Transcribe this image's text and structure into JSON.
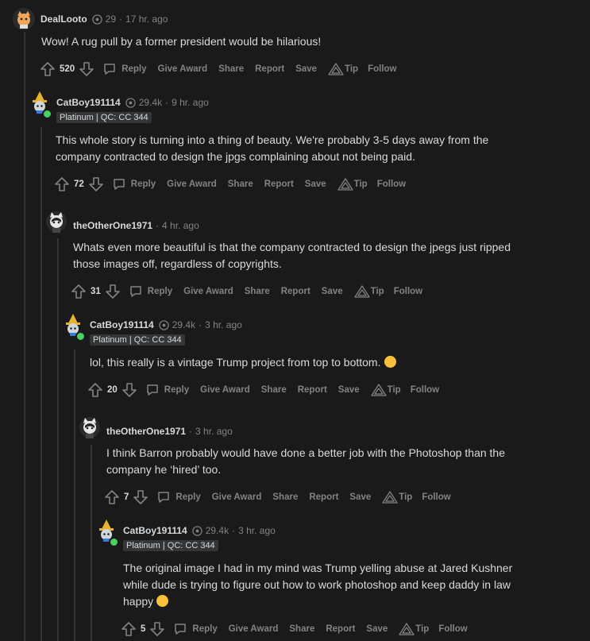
{
  "comments": [
    {
      "username": "DealLooto",
      "karma": "29",
      "time": "17 hr. ago",
      "flair": "",
      "body": "Wow! A rug pull by a former president would be hilarious!",
      "score": "520",
      "avatar": "cat-avatar-orange"
    },
    {
      "username": "CatBoy191114",
      "karma": "29.4k",
      "time": "9 hr. ago",
      "flair": "Platinum | QC: CC 344",
      "body_lines": [
        "This whole story is turning into a thing of beauty. We're probably 3-5 days away from the",
        "company contracted to design the jpgs complaining about not being paid."
      ],
      "score": "72",
      "avatar": "cat-avatar-witch"
    },
    {
      "username": "theOtherOne1971",
      "karma": "",
      "time": "4 hr. ago",
      "flair": "",
      "body_lines": [
        "Whats even more beautiful is that the company contracted to design the jpegs just ripped",
        "those images off, regardless of copyrights."
      ],
      "score": "31",
      "avatar": "cat-avatar-bw"
    },
    {
      "username": "CatBoy191114",
      "karma": "29.4k",
      "time": "3 hr. ago",
      "flair": "Platinum | QC: CC 344",
      "body": "lol, this really is a vintage Trump project from top to bottom.",
      "score": "20",
      "avatar": "cat-avatar-witch"
    },
    {
      "username": "theOtherOne1971",
      "karma": "",
      "time": "3 hr. ago",
      "flair": "",
      "body_lines": [
        "I think Barron probably would have done a better job with the Photoshop than the",
        "company he ‘hired’ too."
      ],
      "score": "7",
      "avatar": "cat-avatar-bw"
    },
    {
      "username": "CatBoy191114",
      "karma": "29.4k",
      "time": "3 hr. ago",
      "flair": "Platinum | QC: CC 344",
      "body_lines": [
        "The original image I had in my mind was Trump yelling abuse at Jared Kushner",
        "while dude is trying to figure out how to work photoshop and keep daddy in law",
        "happy"
      ],
      "score": "5",
      "avatar": "cat-avatar-witch"
    }
  ],
  "actions": {
    "reply": "Reply",
    "give_award": "Give Award",
    "share": "Share",
    "report": "Report",
    "save": "Save",
    "tip": "Tip",
    "follow": "Follow"
  },
  "separator": "·",
  "colors": {
    "background": "#1a1a1b",
    "text": "#d7dadc",
    "muted": "#818384",
    "thread_line": "#343536",
    "online": "#46d160"
  }
}
